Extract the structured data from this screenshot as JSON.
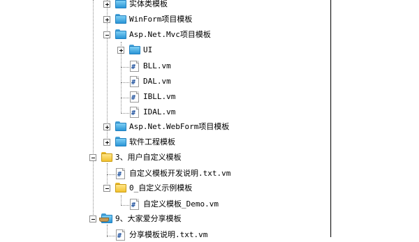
{
  "tree": {
    "items": [
      {
        "label": "实体类模板",
        "icon": "folder-blue",
        "expander": "plus"
      },
      {
        "label": "WinForm项目模板",
        "icon": "folder-blue",
        "expander": "plus"
      },
      {
        "label": "Asp.Net.Mvc项目模板",
        "icon": "folder-blue",
        "expander": "minus"
      },
      {
        "label": "UI",
        "icon": "folder-blue",
        "expander": "plus"
      },
      {
        "label": "BLL.vm",
        "icon": "file-csharp"
      },
      {
        "label": "DAL.vm",
        "icon": "file-csharp"
      },
      {
        "label": "IBLL.vm",
        "icon": "file-csharp"
      },
      {
        "label": "IDAL.vm",
        "icon": "file-csharp"
      },
      {
        "label": "Asp.Net.WebForm项目模板",
        "icon": "folder-blue",
        "expander": "plus"
      },
      {
        "label": "软件工程模板",
        "icon": "folder-blue",
        "expander": "plus"
      },
      {
        "label": "3、用户自定义模板",
        "icon": "folder-yellow",
        "expander": "minus"
      },
      {
        "label": "自定义模板开发说明.txt.vm",
        "icon": "file-csharp"
      },
      {
        "label": "0_自定义示例模板",
        "icon": "folder-yellow",
        "expander": "minus"
      },
      {
        "label": "自定义模板_Demo.vm",
        "icon": "file-csharp"
      },
      {
        "label": "9、大家爱分享模板",
        "icon": "folder-shared",
        "expander": "minus"
      },
      {
        "label": "分享模板说明.txt.vm",
        "icon": "file-csharp"
      }
    ]
  },
  "colors": {
    "folder_blue": "#2b95d6",
    "folder_yellow": "#f2c230",
    "file_hash": "#1c4f9c",
    "separator": "#222222"
  }
}
